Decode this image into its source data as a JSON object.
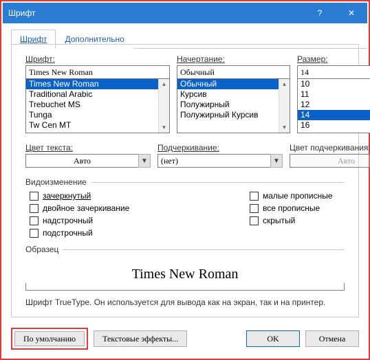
{
  "window": {
    "title": "Шрифт",
    "help_icon": "?",
    "close_icon": "✕"
  },
  "tabs": {
    "font": "Шрифт",
    "advanced": "Дополнительно"
  },
  "labels": {
    "font": "Шрифт:",
    "style": "Начертание:",
    "size": "Размер:",
    "font_color": "Цвет текста:",
    "underline": "Подчеркивание:",
    "underline_color": "Цвет подчеркивания:",
    "effects": "Видоизменение",
    "sample": "Образец"
  },
  "font": {
    "value": "Times New Roman",
    "items": [
      "Times New Roman",
      "Traditional Arabic",
      "Trebuchet MS",
      "Tunga",
      "Tw Cen MT"
    ],
    "selected_index": 0
  },
  "style": {
    "value": "Обычный",
    "items": [
      "Обычный",
      "Курсив",
      "Полужирный",
      "Полужирный Курсив"
    ],
    "selected_index": 0
  },
  "size": {
    "value": "14",
    "items": [
      "10",
      "11",
      "12",
      "14",
      "16"
    ],
    "selected_index": 3
  },
  "combos": {
    "font_color": "Авто",
    "underline": "(нет)",
    "underline_color": "Авто"
  },
  "effects_left": {
    "strike": "зачеркнутый",
    "dblstrike": "двойное зачеркивание",
    "superscript": "надстрочный",
    "subscript": "подстрочный"
  },
  "effects_right": {
    "smallcaps": "малые прописные",
    "allcaps": "все прописные",
    "hidden": "скрытый"
  },
  "sample_text": "Times New Roman",
  "note": "Шрифт TrueType. Он используется для вывода как на экран, так и на принтер.",
  "buttons": {
    "set_default": "По умолчанию",
    "text_effects": "Текстовые эффекты...",
    "ok": "OK",
    "cancel": "Отмена"
  }
}
